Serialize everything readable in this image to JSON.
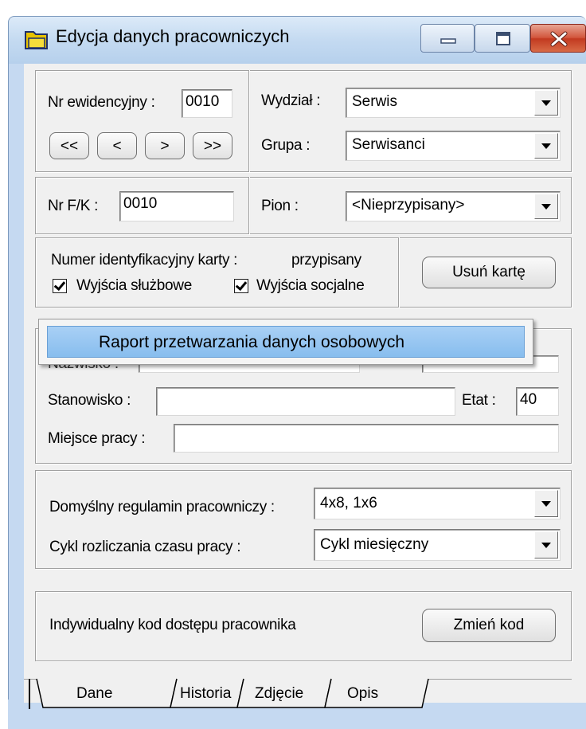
{
  "window": {
    "title": "Edycja danych pracowniczych",
    "icon": "app-folder-icon"
  },
  "record": {
    "nr_ewidencyjny_label": "Nr ewidencyjny :",
    "nr_ewidencyjny_value": "0010",
    "nav": {
      "first": "<<",
      "prev": "<",
      "next": ">",
      "last": ">>"
    },
    "wydzial_label": "Wydział :",
    "wydzial_value": "Serwis",
    "grupa_label": "Grupa :",
    "grupa_value": "Serwisanci",
    "nr_fk_label": "Nr F/K :",
    "nr_fk_value": "0010",
    "pion_label": "Pion :",
    "pion_value": "<Nieprzypisany>"
  },
  "card": {
    "label": "Numer identyfikacyjny karty :",
    "status": "przypisany",
    "chk_sluzbowe_label": "Wyjścia służbowe",
    "chk_sluzbowe_checked": true,
    "chk_socjalne_label": "Wyjścia socjalne",
    "chk_socjalne_checked": true,
    "remove_button": "Usuń kartę"
  },
  "person": {
    "nazwisko_label": "Nazwisko :",
    "stanowisko_label": "Stanowisko :",
    "stanowisko_value": "",
    "etat_label": "Etat :",
    "etat_value": "40",
    "miejsce_label": "Miejsce pracy :",
    "miejsce_value": ""
  },
  "popup": {
    "item": "Raport przetwarzania danych osobowych"
  },
  "schedule": {
    "regulamin_label": "Domyślny regulamin pracowniczy :",
    "regulamin_value": "4x8, 1x6",
    "cykl_label": "Cykl rozliczania czasu pracy :",
    "cykl_value": "Cykl miesięczny"
  },
  "access": {
    "label": "Indywidualny kod dostępu pracownika",
    "button": "Zmień kod"
  },
  "tabs": [
    "Dane",
    "Historia",
    "Zdjęcie",
    "Opis"
  ],
  "colors": {
    "titlebar": "#c4daf1",
    "close_button": "#c23a20",
    "highlight": "#99c8f2"
  }
}
